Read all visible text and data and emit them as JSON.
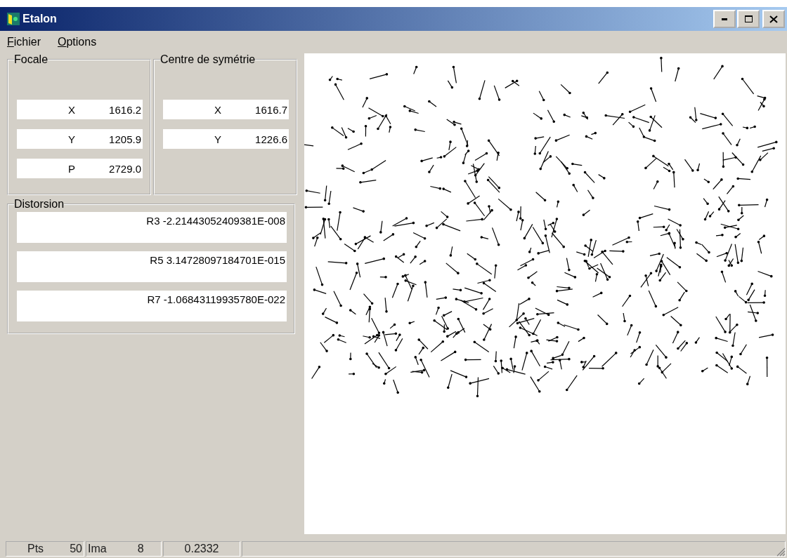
{
  "window": {
    "title": "Etalon"
  },
  "menu": [
    {
      "label": "Fichier"
    },
    {
      "label": "Options"
    }
  ],
  "groups": [
    {
      "title": "Focale",
      "fields": [
        {
          "label": "X",
          "value": "1616.2"
        },
        {
          "label": "Y",
          "value": "1205.9"
        },
        {
          "label": "P",
          "value": "2729.0"
        }
      ]
    },
    {
      "title": "Centre de symétrie",
      "fields": [
        {
          "label": "X",
          "value": "1616.7"
        },
        {
          "label": "Y",
          "value": "1226.6"
        }
      ]
    }
  ],
  "distorsion": {
    "title": "Distorsion",
    "fields": [
      "R3 -2.21443052409381E-008",
      "R5 3.14728097184701E-015",
      "R7 -1.06843119935780E-022"
    ]
  },
  "status_bar": [
    {
      "label": "Pts",
      "value": "50"
    },
    {
      "label": "Ima",
      "value": "8"
    },
    {
      "value": "0.2332"
    }
  ]
}
